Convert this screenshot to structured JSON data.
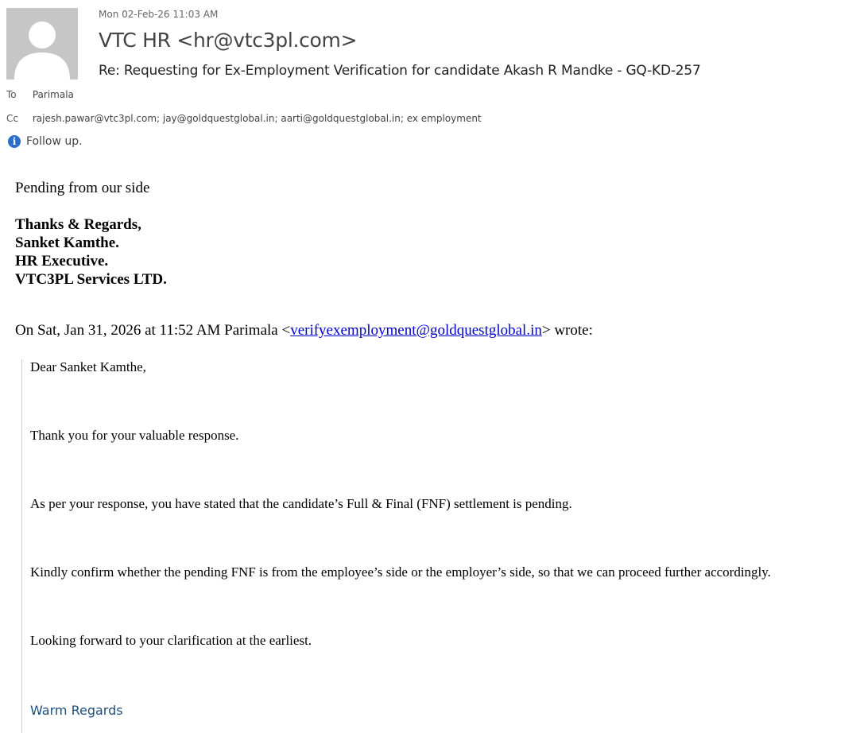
{
  "header": {
    "date": "Mon 02-Feb-26 11:03 AM",
    "from": "VTC HR <hr@vtc3pl.com>",
    "subject": "Re: Requesting for Ex-Employment Verification for candidate Akash R Mandke - GQ-KD-257",
    "to_label": "To",
    "to": "Parimala",
    "cc_label": "Cc",
    "cc": "rajesh.pawar@vtc3pl.com; jay@goldquestglobal.in; aarti@goldquestglobal.in; ex employment",
    "followup": "Follow up.",
    "avatar_icon": "person-icon",
    "info_icon": "info-icon"
  },
  "body": {
    "line1": "Pending from our side",
    "sig1": "Thanks & Regards,",
    "sig2": "Sanket Kamthe.",
    "sig3": "HR Executive.",
    "sig4": "VTC3PL Services LTD.",
    "wrote_prefix": "On Sat, Jan 31, 2026 at 11:52 AM Parimala <",
    "wrote_link": "verifyexemployment@goldquestglobal.in",
    "wrote_suffix": "> wrote:"
  },
  "quoted": {
    "greeting": "Dear Sanket Kamthe,",
    "p1": "Thank you for your valuable response.",
    "p2": "As per your response, you have stated that the candidate’s Full & Final (FNF) settlement is pending.",
    "p3": "Kindly confirm whether the pending FNF is from the employee’s side or the employer’s side, so that we can proceed further accordingly.",
    "p4": "Looking forward to your clarification at the earliest.",
    "closing": "Warm Regards"
  },
  "colors": {
    "link": "#0000cc",
    "info_icon": "#2a6fc9",
    "warm_regards": "#1f4e79",
    "avatar_bg": "#c6c6c6"
  }
}
